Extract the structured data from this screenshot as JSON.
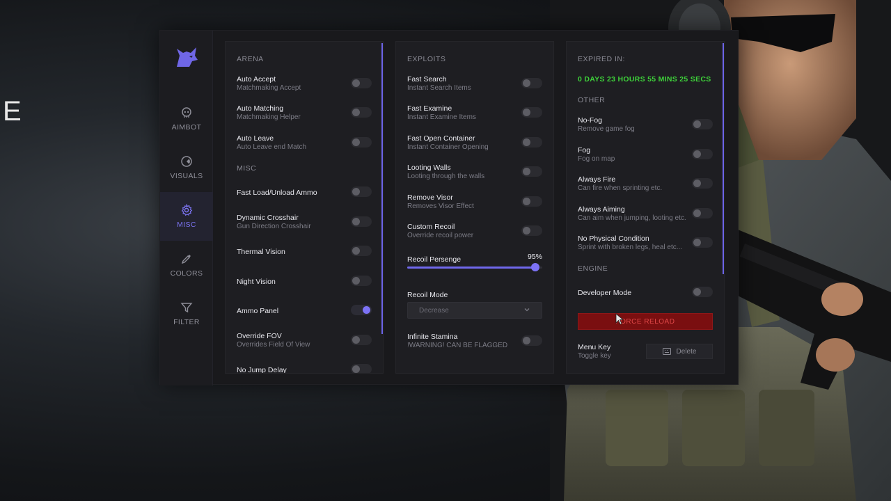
{
  "background": {
    "letter": "E"
  },
  "sidebar": {
    "items": [
      {
        "label": "AIMBOT",
        "icon": "skull-icon",
        "active": false
      },
      {
        "label": "VISUALS",
        "icon": "visuals-icon",
        "active": false
      },
      {
        "label": "MISC",
        "icon": "gear-icon",
        "active": true
      },
      {
        "label": "COLORS",
        "icon": "eyedropper-icon",
        "active": false
      },
      {
        "label": "FILTER",
        "icon": "filter-icon",
        "active": false
      }
    ]
  },
  "arena": {
    "section_title": "ARENA",
    "items": [
      {
        "title": "Auto Accept",
        "subtitle": "Matchmaking Accept",
        "on": false
      },
      {
        "title": "Auto Matching",
        "subtitle": "Matchmaking Helper",
        "on": false
      },
      {
        "title": "Auto Leave",
        "subtitle": "Auto Leave end Match",
        "on": false
      }
    ],
    "misc_title": "MISC",
    "misc_items": [
      {
        "title": "Fast Load/Unload Ammo",
        "subtitle": "",
        "on": false
      },
      {
        "title": "Dynamic Crosshair",
        "subtitle": "Gun Direction Crosshair",
        "on": false
      },
      {
        "title": "Thermal Vision",
        "subtitle": "",
        "on": false
      },
      {
        "title": "Night Vision",
        "subtitle": "",
        "on": false
      },
      {
        "title": "Ammo Panel",
        "subtitle": "",
        "on": true
      },
      {
        "title": "Override FOV",
        "subtitle": "Overrides Field Of View",
        "on": false
      },
      {
        "title": "No Jump Delay",
        "subtitle": "",
        "on": false
      }
    ]
  },
  "exploits": {
    "section_title": "EXPLOITS",
    "items": [
      {
        "title": "Fast Search",
        "subtitle": "Instant Search Items",
        "on": false
      },
      {
        "title": "Fast Examine",
        "subtitle": "Instant Examine Items",
        "on": false
      },
      {
        "title": "Fast Open Container",
        "subtitle": "Instant Container Opening",
        "on": false
      },
      {
        "title": "Looting Walls",
        "subtitle": "Looting through the walls",
        "on": false
      },
      {
        "title": "Remove Visor",
        "subtitle": "Removes Visor Effect",
        "on": false
      },
      {
        "title": "Custom Recoil",
        "subtitle": "Override recoil power",
        "on": false
      }
    ],
    "recoil_slider": {
      "label": "Recoil Persenge",
      "value_text": "95%",
      "value": 95
    },
    "recoil_mode": {
      "label": "Recoil Mode",
      "selected": "Decrease"
    },
    "stamina": {
      "title": "Infinite Stamina",
      "subtitle": "!WARNING! CAN BE FLAGGED",
      "on": false
    }
  },
  "right": {
    "expired_label": "EXPIRED IN:",
    "expired_value": "0 DAYS 23 HOURS 55 MINS 25 SECS",
    "other_title": "OTHER",
    "items": [
      {
        "title": "No-Fog",
        "subtitle": "Remove game fog",
        "on": false
      },
      {
        "title": "Fog",
        "subtitle": "Fog on map",
        "on": false
      },
      {
        "title": "Always Fire",
        "subtitle": "Can fire when sprinting etc.",
        "on": false
      },
      {
        "title": "Always Aiming",
        "subtitle": "Can aim when jumping, looting etc.",
        "on": false
      },
      {
        "title": "No Physical Condition",
        "subtitle": "Sprint with broken legs, heal etc...",
        "on": false
      }
    ],
    "engine_title": "ENGINE",
    "developer_mode": {
      "title": "Developer Mode",
      "on": false
    },
    "force_reload": "FORCE RELOAD",
    "menu_key": {
      "title": "Menu Key",
      "subtitle": "Toggle key",
      "key": "Delete"
    }
  },
  "colors": {
    "accent": "#7c72f5",
    "timer": "#3ed23a",
    "danger": "#7a0f10"
  }
}
